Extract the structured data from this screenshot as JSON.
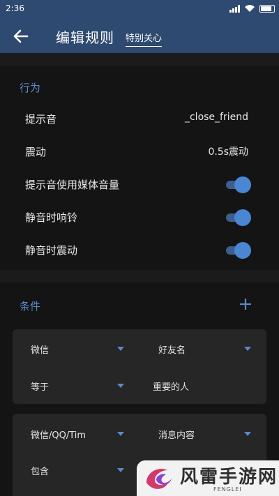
{
  "status_bar": {
    "time": "2:36"
  },
  "app_bar": {
    "title": "编辑规则",
    "subtitle": "特别关心"
  },
  "behavior": {
    "header": "行为",
    "rows": [
      {
        "label": "提示音",
        "value": "_close_friend"
      },
      {
        "label": "震动",
        "value": "0.5s震动"
      },
      {
        "label": "提示音使用媒体音量",
        "toggle": true
      },
      {
        "label": "静音时响铃",
        "toggle": true
      },
      {
        "label": "静音时震动",
        "toggle": true
      }
    ]
  },
  "conditions": {
    "header": "条件",
    "cards": [
      {
        "app": "微信",
        "field": "好友名",
        "operator": "等于",
        "value": "重要的人"
      },
      {
        "app": "微信/QQ/Tim",
        "field": "消息内容",
        "operator": "包含",
        "value": ""
      }
    ]
  },
  "watermark": {
    "name": "风雷手游网",
    "latin": "FENGLEI"
  },
  "colors": {
    "appbar": "#2f4a70",
    "accent": "#5b89c7",
    "toggle_on": "#4a86d1",
    "background": "#141414"
  }
}
